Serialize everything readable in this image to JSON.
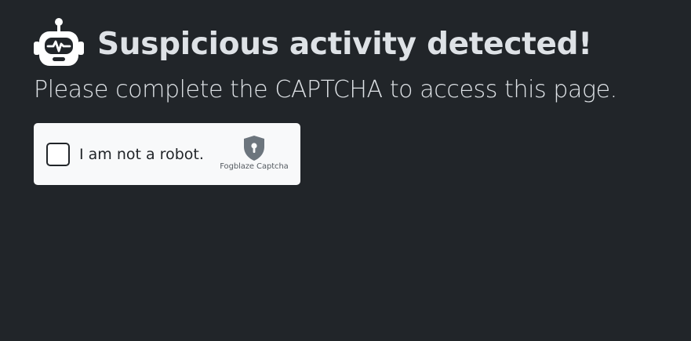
{
  "header": {
    "icon": "robot-icon",
    "title": "Suspicious activity detected!",
    "subtitle": "Please complete the CAPTCHA to access this page."
  },
  "captcha": {
    "checked": false,
    "label": "I am not a robot.",
    "brand_icon": "shield-keyhole-icon",
    "brand_name": "Fogblaze Captcha"
  },
  "colors": {
    "background": "#212529",
    "text": "#dee2e6",
    "widget_background": "#f8f9fa",
    "widget_text": "#212529"
  }
}
